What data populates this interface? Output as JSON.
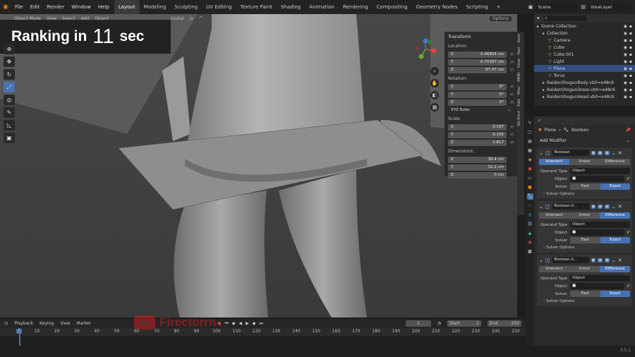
{
  "menu": [
    "File",
    "Edit",
    "Render",
    "Window",
    "Help"
  ],
  "workspaces": [
    "Layout",
    "Modeling",
    "Sculpting",
    "UV Editing",
    "Texture Paint",
    "Shading",
    "Animation",
    "Rendering",
    "Compositing",
    "Geometry Nodes",
    "Scripting"
  ],
  "active_workspace": "Layout",
  "scene": "Scene",
  "view_layer": "ViewLayer",
  "viewport_header": {
    "mode": "Object Mode",
    "view": "View",
    "select": "Select",
    "add": "Add",
    "object": "Object",
    "orientation": "Global",
    "options": "Options"
  },
  "overlay": {
    "prefix": "Ranking in",
    "number": "11",
    "suffix": "sec"
  },
  "npanel": {
    "title": "Transform",
    "location_label": "Location:",
    "location": [
      {
        "axis": "X",
        "value": "-0.46804 cm"
      },
      {
        "axis": "Y",
        "value": "-0.70397 cm"
      },
      {
        "axis": "Z",
        "value": "97.47 cm"
      }
    ],
    "rotation_label": "Rotation:",
    "rotation": [
      {
        "axis": "X",
        "value": "0°"
      },
      {
        "axis": "Y",
        "value": "0°"
      },
      {
        "axis": "Z",
        "value": "0°"
      }
    ],
    "rotation_mode": "XYZ Euler",
    "scale_label": "Scale:",
    "scale": [
      {
        "axis": "X",
        "value": "0.197"
      },
      {
        "axis": "Y",
        "value": "0.155"
      },
      {
        "axis": "Z",
        "value": "1.817"
      }
    ],
    "dimensions_label": "Dimensions:",
    "dimensions": [
      {
        "axis": "X",
        "value": "39.4 cm"
      },
      {
        "axis": "Y",
        "value": "31.1 cm"
      },
      {
        "axis": "Z",
        "value": "0 cm"
      }
    ]
  },
  "side_tabs": [
    "Item",
    "Tool",
    "View",
    "MMD",
    "Misc",
    "Edit",
    "3D-Print"
  ],
  "outliner": {
    "rows": [
      {
        "label": "Scene Collection",
        "indent": 0,
        "sel": false
      },
      {
        "label": "Collection",
        "indent": 1,
        "sel": false
      },
      {
        "label": "Camera",
        "indent": 2,
        "sel": false
      },
      {
        "label": "Cube",
        "indent": 2,
        "sel": false
      },
      {
        "label": "Cube.001",
        "indent": 2,
        "sel": false
      },
      {
        "label": "Light",
        "indent": 2,
        "sel": false
      },
      {
        "label": "Plane",
        "indent": 2,
        "sel": true
      },
      {
        "label": "Torus",
        "indent": 2,
        "sel": false
      },
      {
        "label": "RaidenShogunBody-vb0=e48c6",
        "indent": 1,
        "sel": false
      },
      {
        "label": "RaidenShogunDress-vb0=e48c6",
        "indent": 1,
        "sel": false
      },
      {
        "label": "RaidenShogunHead-vb0=e48c6",
        "indent": 1,
        "sel": false
      }
    ]
  },
  "properties": {
    "object": "Plane",
    "modifier_crumb": "Boolean",
    "add_modifier": "Add Modifier",
    "modifiers": [
      {
        "name": "Boolean",
        "ops": [
          "Intersect",
          "Union",
          "Difference"
        ],
        "active_op": "Intersect",
        "operand_label": "Operand Type",
        "operand": "Object",
        "object_label": "Object",
        "solver_label": "Solver",
        "solvers": [
          "Fast",
          "Exact"
        ],
        "active_solver": "Exact",
        "solver_options": "Solver Options"
      },
      {
        "name": "Boolean.0...",
        "ops": [
          "Intersect",
          "Union",
          "Difference"
        ],
        "active_op": "Difference",
        "operand_label": "Operand Type",
        "operand": "Object",
        "object_label": "Object",
        "solver_label": "Solver",
        "solvers": [
          "Fast",
          "Exact"
        ],
        "active_solver": "Exact",
        "solver_options": "Solver Options"
      },
      {
        "name": "Boolean.0...",
        "ops": [
          "Intersect",
          "Union",
          "Difference"
        ],
        "active_op": "Difference",
        "operand_label": "Operand Type",
        "operand": "Object",
        "object_label": "Object",
        "solver_label": "Solver",
        "solvers": [
          "Fast",
          "Exact"
        ],
        "active_solver": "Exact",
        "solver_options": "Solver Options"
      }
    ]
  },
  "timeline": {
    "menus": [
      "Playback",
      "Keying",
      "View",
      "Marker"
    ],
    "current_frame": "1",
    "start_label": "Start",
    "start": "1",
    "end_label": "End",
    "end": "250",
    "ticks": [
      "1",
      "10",
      "20",
      "30",
      "40",
      "50",
      "60",
      "70",
      "80",
      "90",
      "100",
      "110",
      "120",
      "130",
      "140",
      "150",
      "160",
      "170",
      "180",
      "190",
      "200",
      "210",
      "220",
      "230",
      "240",
      "250"
    ]
  },
  "watermark": "Firectorrn",
  "version": "3.5.1",
  "colors": {
    "accent": "#4772b3",
    "selected_row": "#334d80",
    "bg": "#1d1d1d",
    "viewport": "#3a3a3a"
  }
}
